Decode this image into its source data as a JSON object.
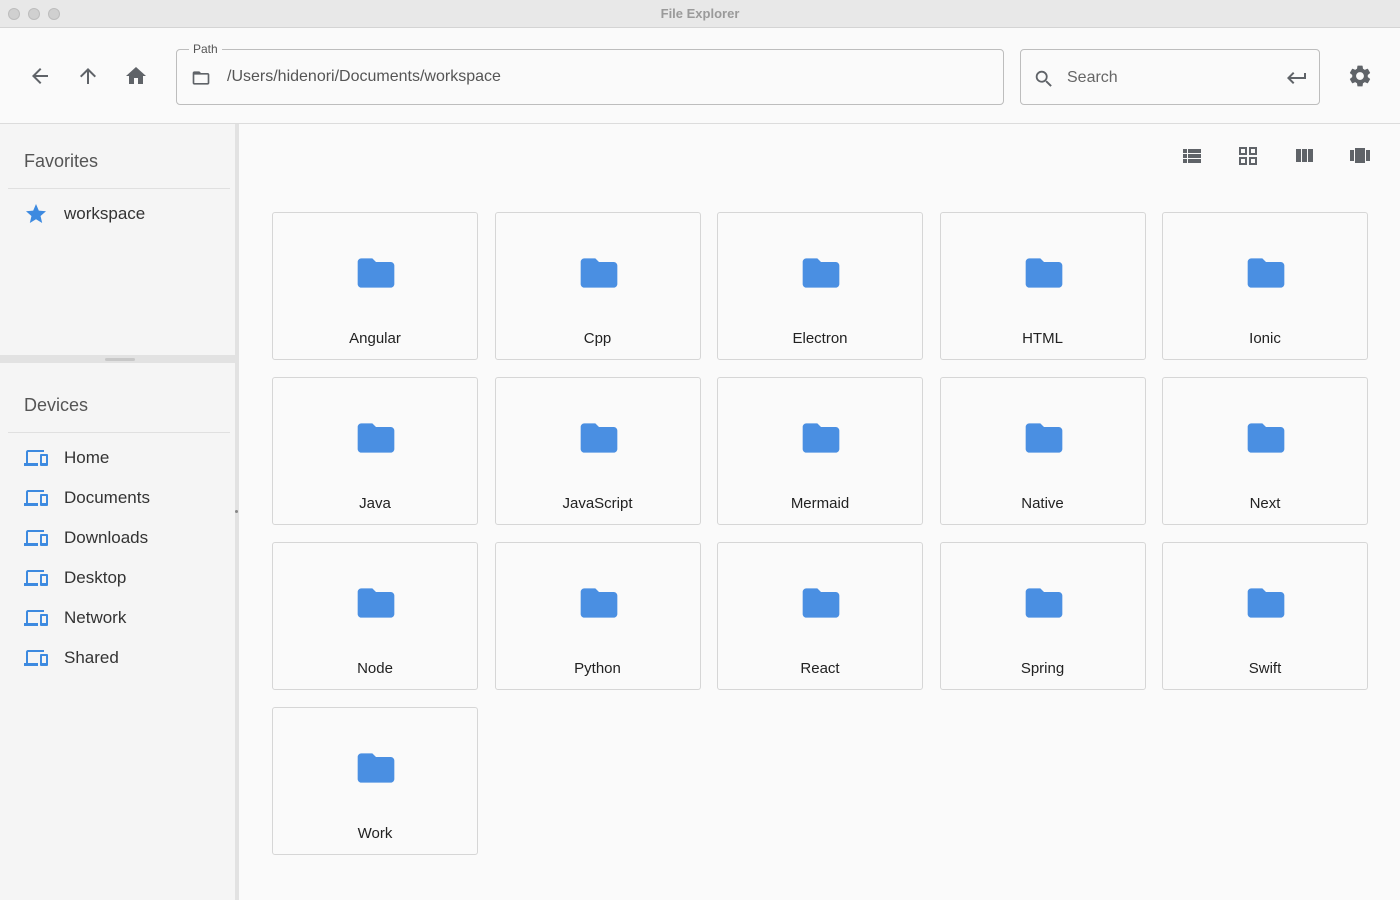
{
  "window": {
    "title": "File Explorer"
  },
  "toolbar": {
    "path_legend": "Path",
    "path_value": "/Users/hidenori/Documents/workspace",
    "search_placeholder": "Search"
  },
  "sidebar": {
    "favorites_title": "Favorites",
    "favorites": [
      {
        "label": "workspace",
        "icon": "star-icon"
      }
    ],
    "devices_title": "Devices",
    "devices": [
      {
        "label": "Home",
        "icon": "devices-icon"
      },
      {
        "label": "Documents",
        "icon": "devices-icon"
      },
      {
        "label": "Downloads",
        "icon": "devices-icon"
      },
      {
        "label": "Desktop",
        "icon": "devices-icon"
      },
      {
        "label": "Network",
        "icon": "devices-icon"
      },
      {
        "label": "Shared",
        "icon": "devices-icon"
      }
    ]
  },
  "main": {
    "view_modes": [
      "list-view-icon",
      "grid-view-icon",
      "column-view-icon",
      "gallery-view-icon"
    ],
    "folders": [
      "Angular",
      "Cpp",
      "Electron",
      "HTML",
      "Ionic",
      "Java",
      "JavaScript",
      "Mermaid",
      "Native",
      "Next",
      "Node",
      "Python",
      "React",
      "Spring",
      "Swift",
      "Work"
    ]
  },
  "colors": {
    "accent": "#3d8ae0",
    "folder": "#4a8fe2",
    "icon_gray": "#5f6368"
  }
}
